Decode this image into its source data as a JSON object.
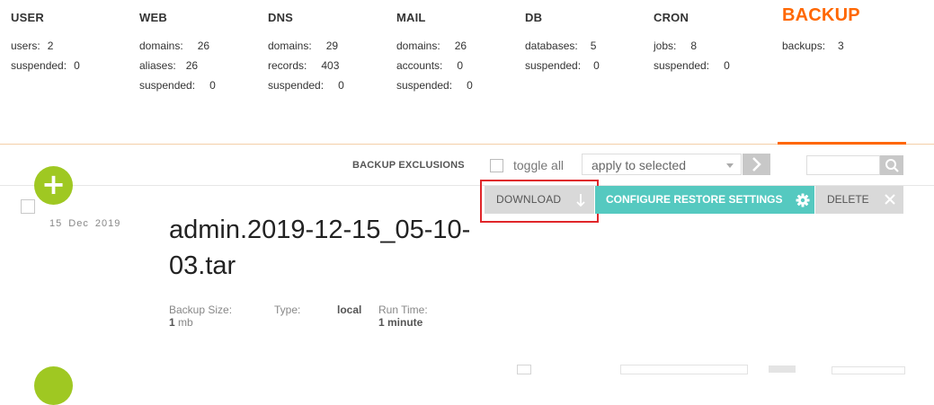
{
  "topnav": {
    "user": {
      "title": "USER",
      "stats": [
        {
          "label": "users:",
          "value": "2"
        },
        {
          "label": "suspended:",
          "value": "0"
        }
      ]
    },
    "web": {
      "title": "WEB",
      "stats": [
        {
          "label": "domains:",
          "value": "26"
        },
        {
          "label": "aliases:",
          "value": "26"
        },
        {
          "label": "suspended:",
          "value": "0"
        }
      ]
    },
    "dns": {
      "title": "DNS",
      "stats": [
        {
          "label": "domains:",
          "value": "29"
        },
        {
          "label": "records:",
          "value": "403"
        },
        {
          "label": "suspended:",
          "value": "0"
        }
      ]
    },
    "mail": {
      "title": "MAIL",
      "stats": [
        {
          "label": "domains:",
          "value": "26"
        },
        {
          "label": "accounts:",
          "value": "0"
        },
        {
          "label": "suspended:",
          "value": "0"
        }
      ]
    },
    "db": {
      "title": "DB",
      "stats": [
        {
          "label": "databases:",
          "value": "5"
        },
        {
          "label": "suspended:",
          "value": "0"
        }
      ]
    },
    "cron": {
      "title": "CRON",
      "stats": [
        {
          "label": "jobs:",
          "value": "8"
        },
        {
          "label": "suspended:",
          "value": "0"
        }
      ]
    },
    "backup": {
      "title": "BACKUP",
      "stats": [
        {
          "label": "backups:",
          "value": "3"
        }
      ]
    }
  },
  "toolbar": {
    "exclusions_link": "BACKUP EXCLUSIONS",
    "toggle_all_label": "toggle all",
    "bulk_select_value": "apply to selected"
  },
  "backup_row": {
    "date": "15 Dec 2019",
    "title": "admin.2019-12-15_05-10-03.tar",
    "size_label": "Backup Size:",
    "size_value": "1",
    "size_unit": "mb",
    "type_label": "Type:",
    "type_value": "local",
    "runtime_label": "Run Time:",
    "runtime_value": "1 minute",
    "actions": {
      "download": "DOWNLOAD",
      "configure_restore": "CONFIGURE RESTORE SETTINGS",
      "delete": "DELETE"
    }
  },
  "colors": {
    "accent": "#ff6701",
    "add_button": "#9fc822",
    "restore_button": "#55c9c0",
    "highlight": "#e0262a"
  },
  "icons": {
    "add": "plus-icon",
    "apply": "chevron-right-icon",
    "search": "search-icon",
    "download": "arrow-down-icon",
    "restore": "gear-icon",
    "delete": "close-icon"
  }
}
